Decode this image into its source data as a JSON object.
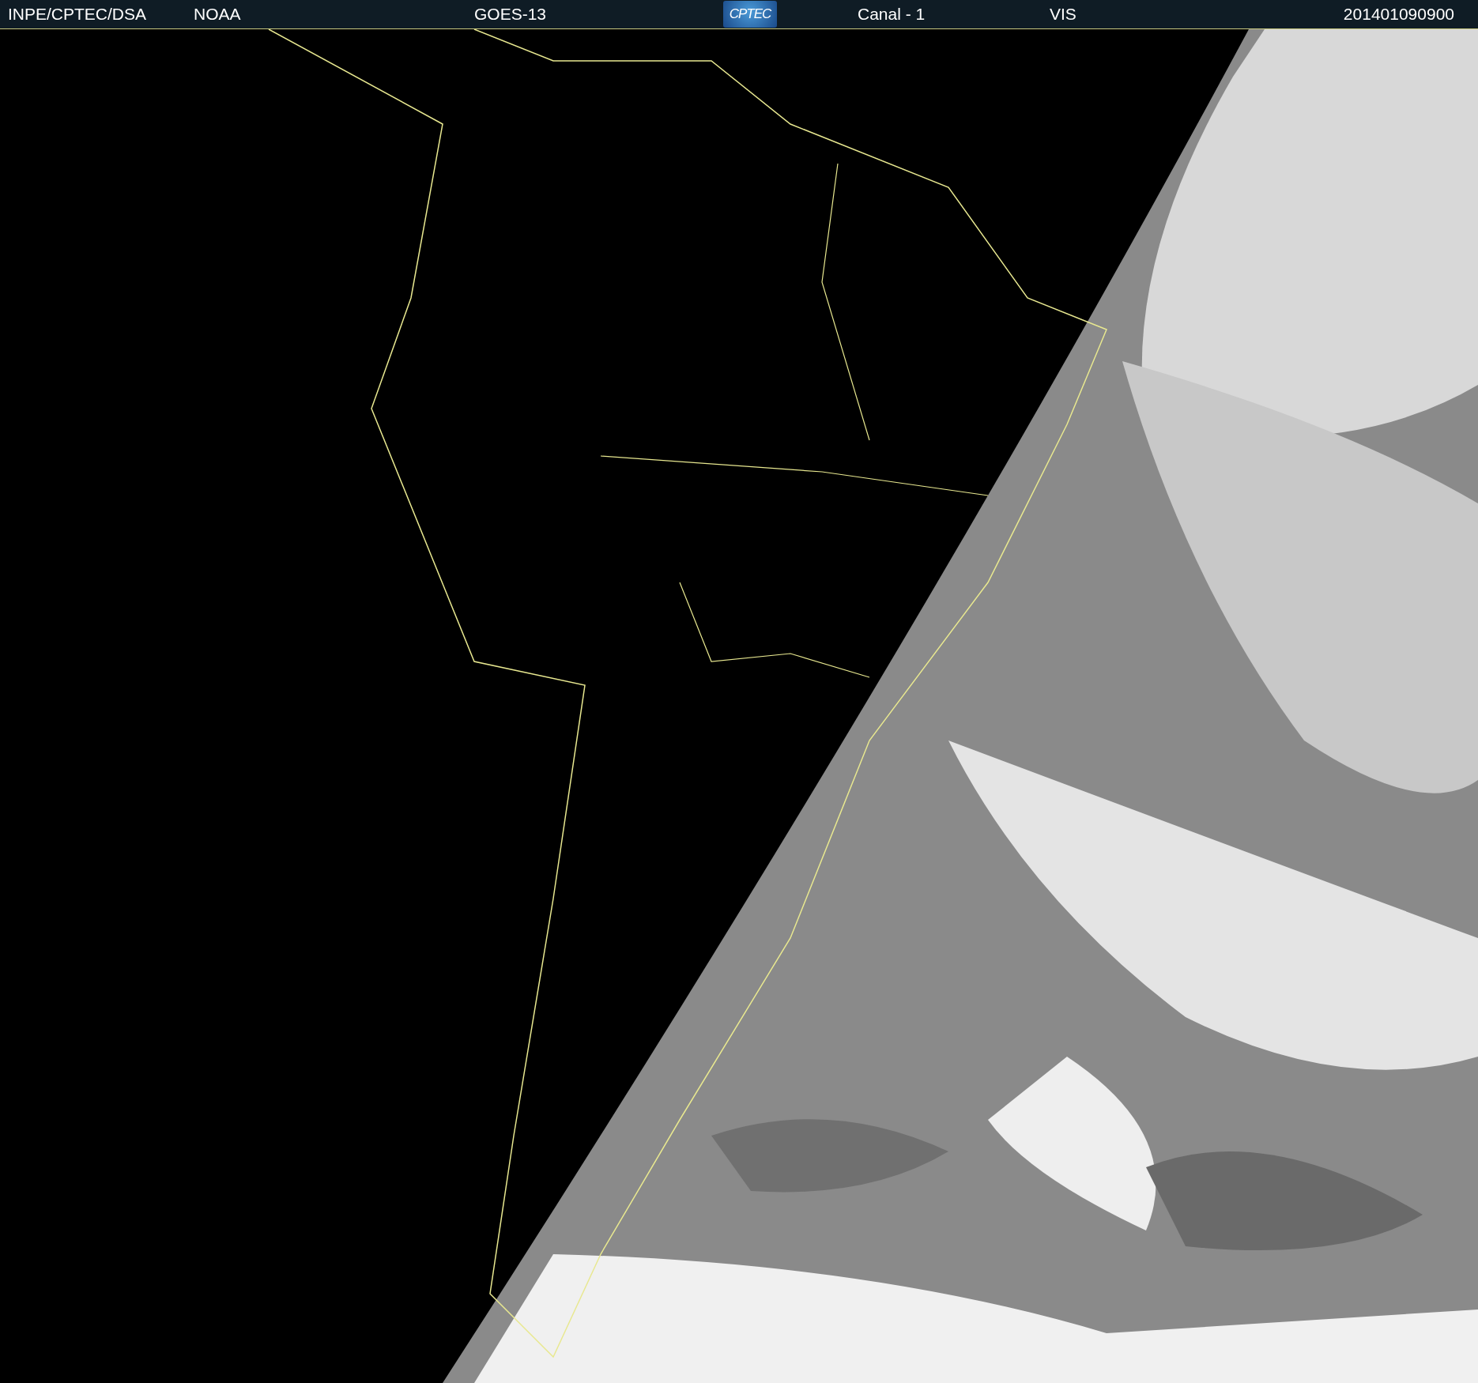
{
  "header": {
    "source": "INPE/CPTEC/DSA",
    "agency": "NOAA",
    "satellite": "GOES-13",
    "logo": "CPTEC",
    "channel": "Canal - 1",
    "band": "VIS",
    "timestamp": "201401090900"
  }
}
